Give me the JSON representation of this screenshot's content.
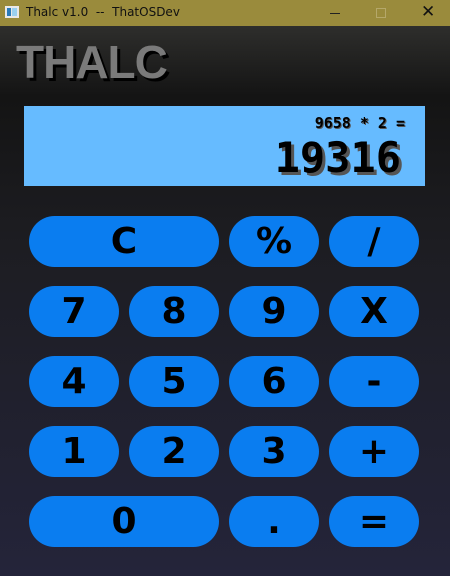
{
  "window": {
    "title": "Thalc v1.0  --  ThatOSDev",
    "close_glyph": "✕",
    "icon": "app-window-icon"
  },
  "app": {
    "brand": "THALC"
  },
  "display": {
    "expression": "9658 * 2 =",
    "result": "19316"
  },
  "keys": {
    "clear": "C",
    "percent": "%",
    "divide": "/",
    "seven": "7",
    "eight": "8",
    "nine": "9",
    "multiply": "X",
    "four": "4",
    "five": "5",
    "six": "6",
    "minus": "-",
    "one": "1",
    "two": "2",
    "three": "3",
    "plus": "+",
    "zero": "0",
    "decimal": ".",
    "equals": "="
  },
  "colors": {
    "titlebar": "#9a8b3c",
    "display_bg": "#66bbff",
    "key_bg": "#0a7df0",
    "brand_text": "#7a7a7a"
  }
}
